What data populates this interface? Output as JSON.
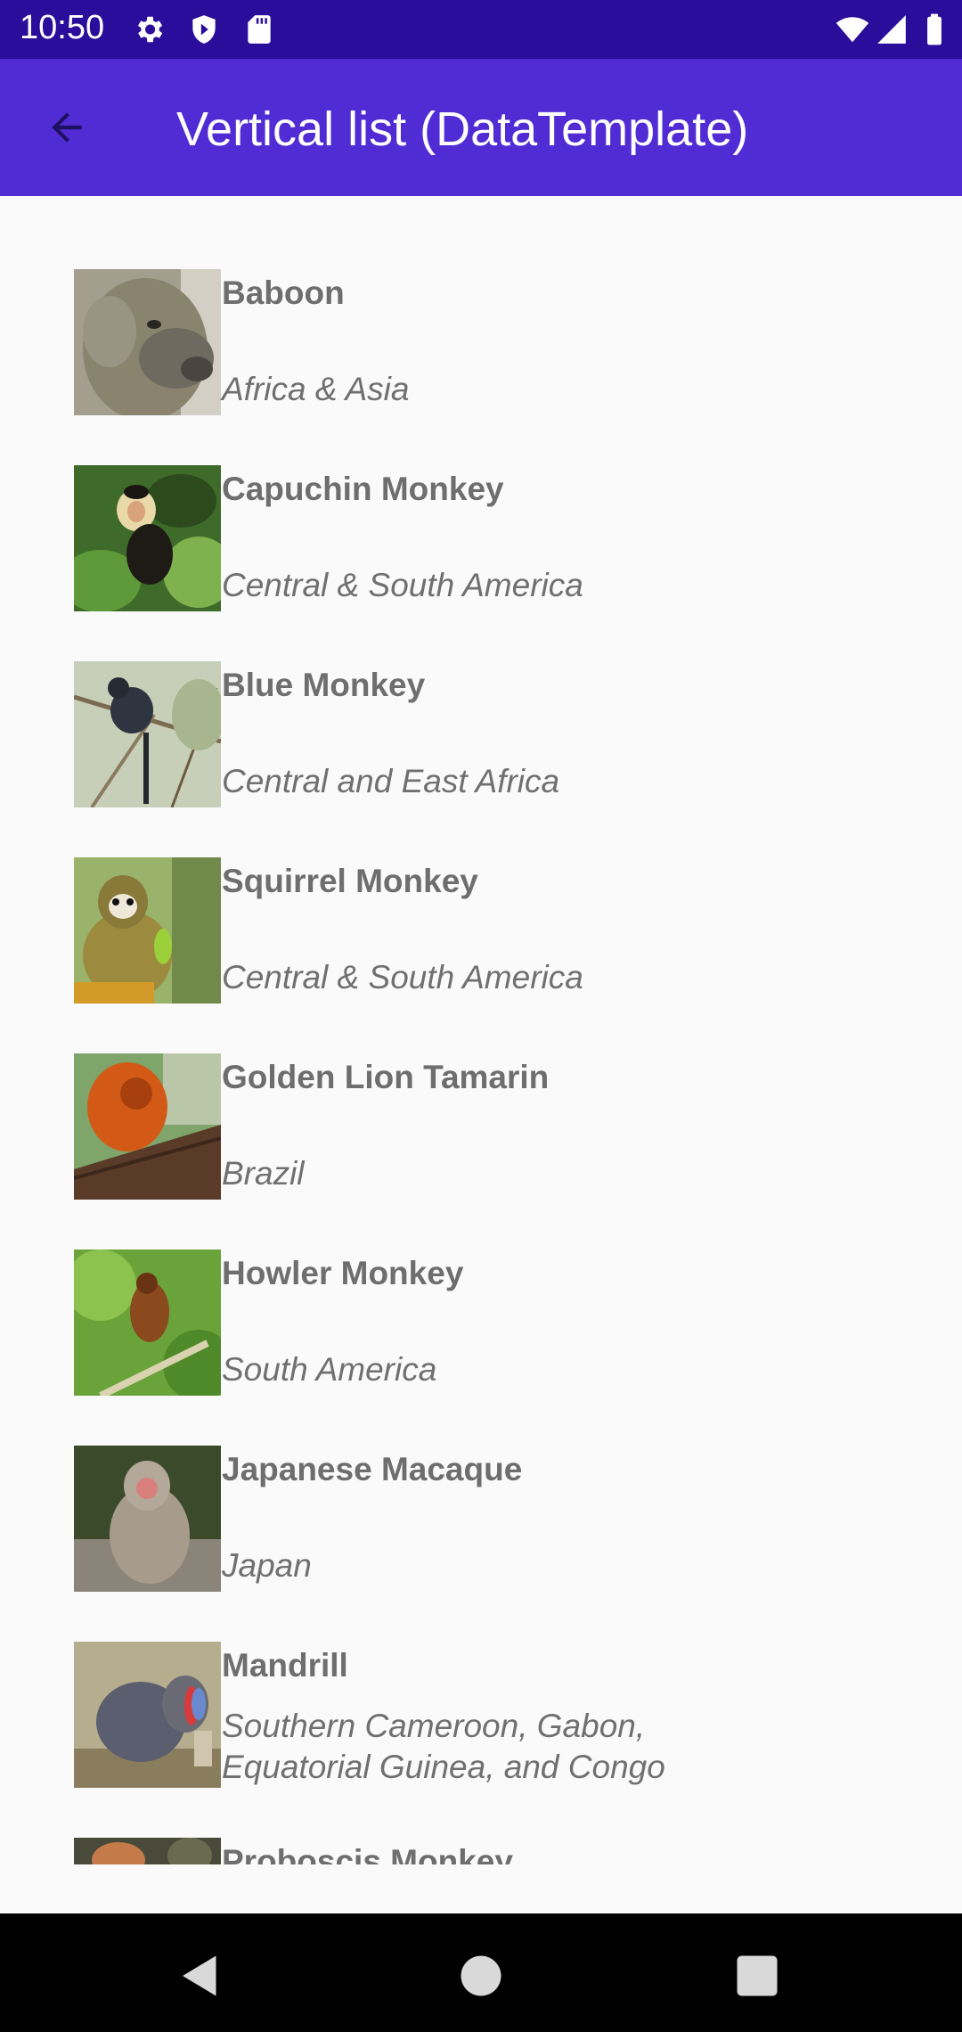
{
  "status_bar": {
    "time": "10:50",
    "icons_left": [
      "gear-icon",
      "shield-play-icon",
      "sd-card-icon"
    ],
    "icons_right": [
      "wifi-icon",
      "cell-signal-icon",
      "battery-icon"
    ]
  },
  "app_bar": {
    "title": "Vertical list (DataTemplate)",
    "back_icon": "arrow-back-icon",
    "color": "#512bd4"
  },
  "items": [
    {
      "name": "Baboon",
      "location": "Africa & Asia"
    },
    {
      "name": "Capuchin Monkey",
      "location": "Central & South America"
    },
    {
      "name": "Blue Monkey",
      "location": "Central and East Africa"
    },
    {
      "name": "Squirrel Monkey",
      "location": "Central & South America"
    },
    {
      "name": "Golden Lion Tamarin",
      "location": "Brazil"
    },
    {
      "name": "Howler Monkey",
      "location": "South America"
    },
    {
      "name": "Japanese Macaque",
      "location": "Japan"
    },
    {
      "name": "Mandrill",
      "location": "Southern Cameroon, Gabon, Equatorial Guinea, and Congo"
    },
    {
      "name": "Proboscis Monkey",
      "location": ""
    }
  ],
  "nav_bar": {
    "buttons": [
      "back-triangle-icon",
      "home-circle-icon",
      "recents-square-icon"
    ]
  }
}
